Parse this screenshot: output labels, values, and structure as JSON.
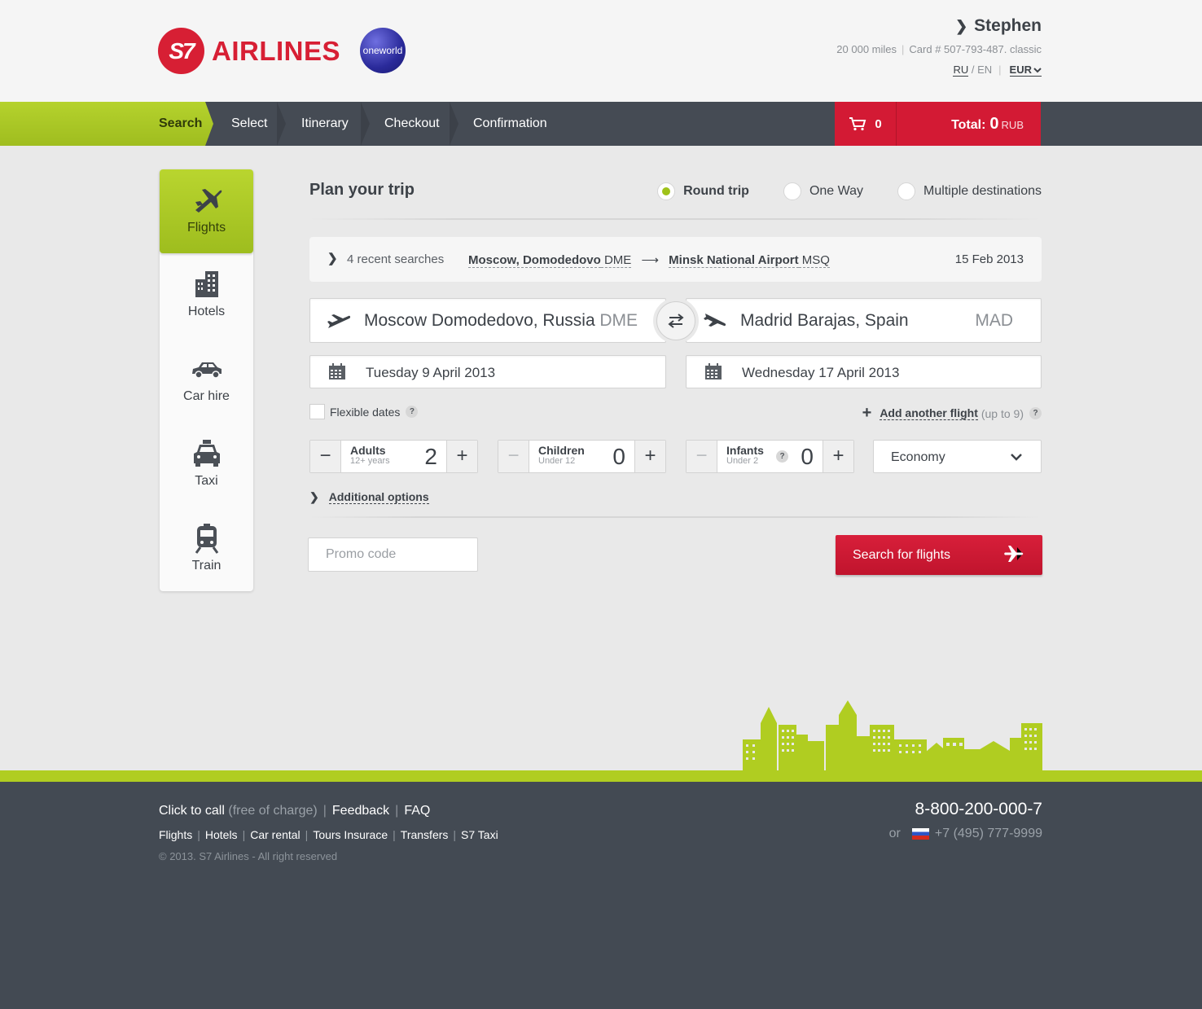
{
  "header": {
    "logo_badge": "S7",
    "logo_text": "AIRLINES",
    "alliance": "oneworld",
    "user": {
      "name": "Stephen",
      "miles": "20 000 miles",
      "card": "Card # 507-793-487. classic"
    },
    "lang_active": "RU",
    "lang_other": "EN",
    "currency": "EUR"
  },
  "steps": [
    "Search",
    "Select",
    "Itinerary",
    "Checkout",
    "Confirmation"
  ],
  "cart": {
    "count": "0",
    "total_label": "Total:",
    "total_value": "0",
    "total_currency": "RUB"
  },
  "sidenav": [
    {
      "label": "Flights",
      "icon": "airplane-icon"
    },
    {
      "label": "Hotels",
      "icon": "building-icon"
    },
    {
      "label": "Car hire",
      "icon": "car-icon"
    },
    {
      "label": "Taxi",
      "icon": "taxi-icon"
    },
    {
      "label": "Train",
      "icon": "train-icon"
    }
  ],
  "plan": {
    "title": "Plan your trip",
    "trip_types": [
      "Round trip",
      "One Way",
      "Multiple destinations"
    ],
    "selected_trip_type": "Round trip"
  },
  "recent": {
    "count_label": "4 recent searches",
    "from_city": "Moscow, Domodedovo",
    "from_code": "DME",
    "to_city": "Minsk National Airport",
    "to_code": "MSQ",
    "date": "15 Feb 2013"
  },
  "route": {
    "from_name": "Moscow Domodedovo, Russia",
    "from_code": "DME",
    "to_name": "Madrid Barajas, Spain",
    "to_code": "MAD"
  },
  "dates": {
    "depart": "Tuesday 9 April 2013",
    "return": "Wednesday 17 April 2013"
  },
  "flexible_label": "Flexible dates",
  "add_flight": {
    "label": "Add another flight",
    "note": "(up to 9)"
  },
  "passengers": [
    {
      "label": "Adults",
      "sub": "12+ years",
      "value": "2"
    },
    {
      "label": "Children",
      "sub": "Under 12",
      "value": "0"
    },
    {
      "label": "Infants",
      "sub": "Under 2",
      "value": "0"
    }
  ],
  "cabin_class": "Economy",
  "additional_options": "Additional options",
  "promo_placeholder": "Promo code",
  "search_button": "Search for flights",
  "footer": {
    "call": "Click to call",
    "call_note": "(free of charge)",
    "feedback": "Feedback",
    "faq": "FAQ",
    "nav": [
      "Flights",
      "Hotels",
      "Car rental",
      "Tours Insurace",
      "Transfers",
      "S7 Taxi"
    ],
    "copyright": "© 2013. S7 Airlines - All right reserved",
    "phone": "8-800-200-000-7",
    "or": "or",
    "phone2": "+7 (495) 777-9999"
  },
  "colors": {
    "brand_red": "#d71f34",
    "accent_green": "#b0cd21",
    "dark_bar": "#454b54"
  }
}
